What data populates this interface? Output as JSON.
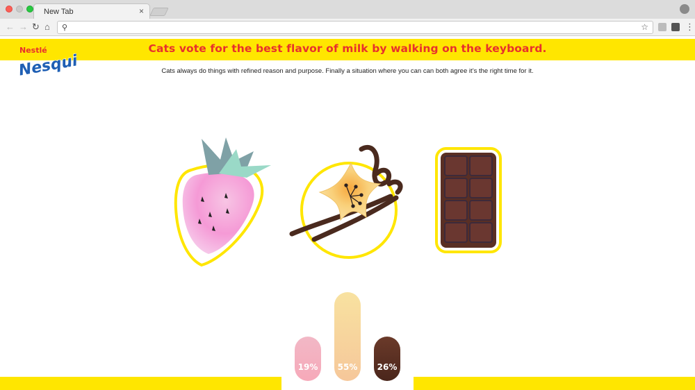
{
  "browser": {
    "tab_title": "New Tab",
    "tab_close": "×",
    "address_value": "",
    "address_placeholder": ""
  },
  "page": {
    "brand_top": "Nestlé",
    "brand_main": "Nesquik",
    "headline": "Cats vote for the best flavor of milk by walking on the keyboard.",
    "subhead": "Cats always do things with refined reason and purpose. Finally a situation where you can can both agree it’s the right time for it."
  },
  "flavors": [
    {
      "name": "strawberry",
      "label": "19%",
      "share": 0.19,
      "color_top": "#f2b8c6",
      "color_bottom": "#f6a9b9"
    },
    {
      "name": "vanilla",
      "label": "55%",
      "share": 0.55,
      "color_top": "#f8e2a0",
      "color_bottom": "#f6c79a"
    },
    {
      "name": "chocolate",
      "label": "26%",
      "share": 0.26,
      "color_top": "#6b3a2a",
      "color_bottom": "#4a261b"
    }
  ],
  "colors": {
    "banner": "#ffe600",
    "headline": "#e8302c",
    "outline": "#ffe600"
  },
  "icons": [
    "back-icon",
    "forward-icon",
    "reload-icon",
    "home-icon",
    "search-icon",
    "star-icon",
    "menu-icon",
    "profile-icon"
  ]
}
